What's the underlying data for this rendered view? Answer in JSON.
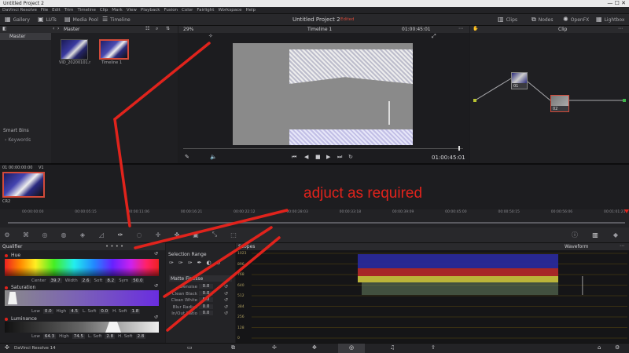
{
  "window": {
    "title": "Untitled Project 2",
    "menu": [
      "DaVinci Resolve",
      "File",
      "Edit",
      "Trim",
      "Timeline",
      "Clip",
      "Mark",
      "View",
      "Playback",
      "Fusion",
      "Color",
      "Fairlight",
      "Workspace",
      "Help"
    ],
    "project_title": "Untitled Project 2",
    "edited_badge": "Edited"
  },
  "toolbar": {
    "gallery": "Gallery",
    "luts": "LUTs",
    "media_pool": "Media Pool",
    "timeline": "Timeline",
    "clips": "Clips",
    "nodes": "Nodes",
    "openfx": "OpenFX",
    "lightbox": "Lightbox"
  },
  "media": {
    "bin_header": "Master",
    "bins": [
      "Master"
    ],
    "smart_bins_label": "Smart Bins",
    "keywords_label": "Keywords",
    "clips": [
      {
        "name": "VID_20200101.mp4"
      },
      {
        "name": "Timeline 1"
      }
    ]
  },
  "viewer": {
    "zoom": "29%",
    "timeline_name": "Timeline 1",
    "timecode_top": "01:00:45:01",
    "timecode_bottom": "01:00:45:01"
  },
  "nodes_panel": {
    "mode": "Clip",
    "node_labels": [
      "01",
      "02"
    ]
  },
  "clip_strip": {
    "clip_timecode": "01  00:00:00:00",
    "clip_track": "V1",
    "clip_codec": "CR2"
  },
  "annotation": {
    "text": "adjuct as required",
    "color": "#e0231c"
  },
  "ruler": {
    "ticks": [
      "00:00:00:00",
      "00:00:05:15",
      "00:00:11:06",
      "00:00:16:21",
      "00:00:22:12",
      "00:00:28:03",
      "00:00:33:18",
      "00:00:39:09",
      "00:00:45:00",
      "00:00:50:15",
      "00:00:56:06",
      "00:01:01:21"
    ]
  },
  "qualifier": {
    "title": "Qualifier",
    "selection_label": "HSL",
    "hue": {
      "label": "Hue",
      "center_label": "Center",
      "center": "39.7",
      "width_label": "Width",
      "width": "2.6",
      "soft_label": "Soft",
      "soft": "8.2",
      "sym_label": "Sym",
      "sym": "50.0"
    },
    "saturation": {
      "label": "Saturation",
      "low_label": "Low",
      "low": "0.0",
      "high_label": "High",
      "high": "4.5",
      "lsoft_label": "L. Soft",
      "lsoft": "0.0",
      "hsoft_label": "H. Soft",
      "hsoft": "1.8"
    },
    "luminance": {
      "label": "Luminance",
      "low_label": "Low",
      "low": "64.3",
      "high_label": "High",
      "high": "74.5",
      "lsoft_label": "L. Soft",
      "lsoft": "2.8",
      "hsoft_label": "H. Soft",
      "hsoft": "2.8"
    }
  },
  "selection_range": {
    "title": "Selection Range",
    "matte_finesse_label": "Matte Finesse",
    "rows": [
      {
        "label": "Denoise",
        "value": "0.0"
      },
      {
        "label": "Clean Black",
        "value": "0.0"
      },
      {
        "label": "Clean White",
        "value": "0.0"
      },
      {
        "label": "Blur Radius",
        "value": "0.0"
      },
      {
        "label": "In/Out Ratio",
        "value": "0.0"
      }
    ]
  },
  "scopes": {
    "title": "Scopes",
    "mode": "Waveform",
    "levels": [
      "1023",
      "896",
      "768",
      "640",
      "512",
      "384",
      "256",
      "128",
      "0"
    ]
  },
  "status": {
    "app_name": "DaVinci Resolve 14"
  },
  "colors": {
    "accent_red": "#d24a3a",
    "hue_dot": "#e0231c"
  }
}
